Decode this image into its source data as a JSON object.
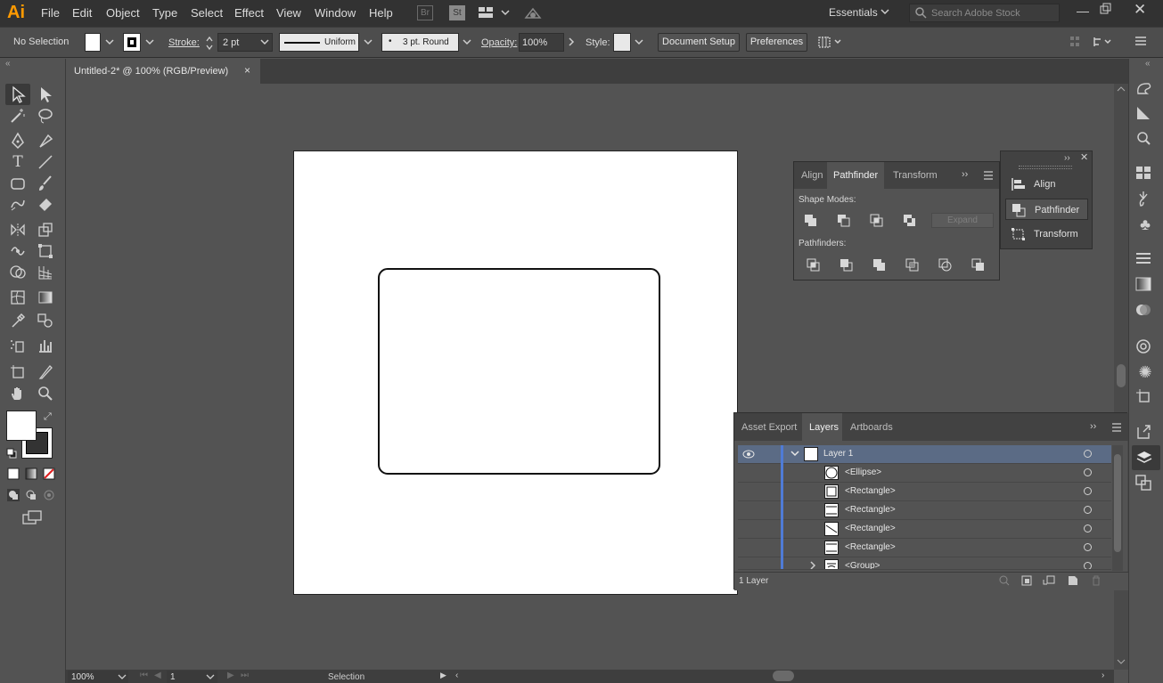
{
  "app": {
    "logo": "Ai"
  },
  "menu": [
    "File",
    "Edit",
    "Object",
    "Type",
    "Select",
    "Effect",
    "View",
    "Window",
    "Help"
  ],
  "menu_icons": {
    "bridge": "Br",
    "stock": "St"
  },
  "workspace": {
    "label": "Essentials"
  },
  "search": {
    "placeholder": "Search Adobe Stock"
  },
  "control": {
    "selection_state": "No Selection",
    "stroke_label": "Stroke:",
    "stroke_value": "2 pt",
    "profile": "Uniform",
    "brush": "3 pt. Round",
    "opacity_label": "Opacity:",
    "opacity_value": "100%",
    "style_label": "Style:",
    "document_setup": "Document Setup",
    "preferences": "Preferences"
  },
  "document": {
    "tab_title": "Untitled-2* @ 100% (RGB/Preview)",
    "close": "×"
  },
  "pathfinder_panel": {
    "tabs": [
      "Align",
      "Pathfinder",
      "Transform"
    ],
    "active_tab": "Pathfinder",
    "shape_modes_label": "Shape Modes:",
    "expand_label": "Expand",
    "pathfinders_label": "Pathfinders:"
  },
  "flyout": {
    "items": [
      "Align",
      "Pathfinder",
      "Transform"
    ],
    "active": "Pathfinder"
  },
  "layers_panel": {
    "tabs": [
      "Asset Export",
      "Layers",
      "Artboards"
    ],
    "active_tab": "Layers",
    "rows": [
      {
        "name": "Layer 1"
      },
      {
        "name": "<Ellipse>"
      },
      {
        "name": "<Rectangle>"
      },
      {
        "name": "<Rectangle>"
      },
      {
        "name": "<Rectangle>"
      },
      {
        "name": "<Rectangle>"
      },
      {
        "name": "<Group>"
      }
    ],
    "footer": "1 Layer"
  },
  "status": {
    "zoom": "100%",
    "artboard": "1",
    "tool": "Selection"
  },
  "colors": {
    "accent": "#4f7bd6",
    "layer_row_selected": "#5b6b85",
    "ui_dark": "#323232",
    "ui_mid": "#535353"
  }
}
